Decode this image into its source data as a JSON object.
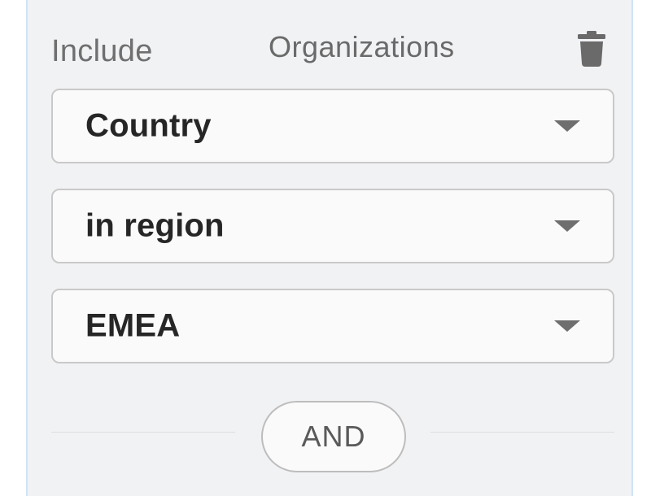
{
  "filter": {
    "mode_label": "Include",
    "entity_label": "Organizations",
    "delete_icon": "trash-icon",
    "field_select": {
      "value": "Country",
      "icon": "caret-down-icon"
    },
    "operator_select": {
      "value": "in region",
      "icon": "caret-down-icon"
    },
    "value_select": {
      "value": "EMEA",
      "icon": "caret-down-icon"
    },
    "combinator_button": {
      "label": "AND"
    }
  },
  "colors": {
    "card_background": "#f1f2f4",
    "card_border": "#cfe3f6",
    "select_border": "#c9c9c9",
    "icon_gray": "#6e6e6e"
  }
}
